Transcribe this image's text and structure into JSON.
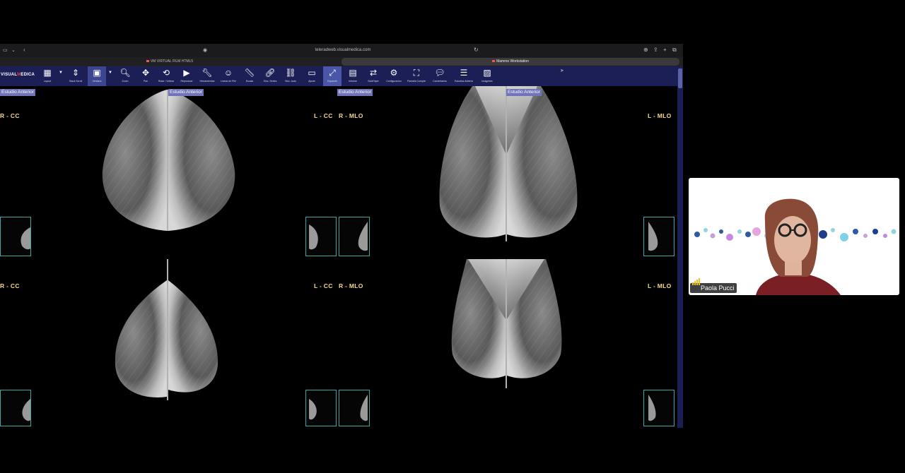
{
  "browser": {
    "url": "teleradweb.visualmedica.com",
    "tabs": [
      {
        "label": "VM VIRTUAL FILM HTML5"
      },
      {
        "label": "Mammo Workstation"
      }
    ]
  },
  "app": {
    "logo_prefix": "VISUAL",
    "logo_mark": "M",
    "logo_suffix": "EDICA"
  },
  "toolbar": [
    {
      "label": "Layout",
      "icon": "grid-icon"
    },
    {
      "label": "Stack Scroll",
      "icon": "scroll-arrows-icon"
    },
    {
      "label": "Ventana",
      "icon": "window-level-icon"
    },
    {
      "label": "Zoom",
      "icon": "magnifier-icon"
    },
    {
      "label": "Pan",
      "icon": "move-icon"
    },
    {
      "label": "Rotar / Voltear",
      "icon": "crop-rotate-icon"
    },
    {
      "label": "Reproducir",
      "icon": "play-icon"
    },
    {
      "label": "Herramientas",
      "icon": "wrench-icon"
    },
    {
      "label": "Lineas de Piel",
      "icon": "person-card-icon"
    },
    {
      "label": "Escala",
      "icon": "ruler-icon"
    },
    {
      "label": "Sinc. Series",
      "icon": "link-icon"
    },
    {
      "label": "Sinc. Auto",
      "icon": "link-auto-icon"
    },
    {
      "label": "Ajuste",
      "icon": "fit-icon"
    },
    {
      "label": "Expandir",
      "icon": "expand-icon"
    },
    {
      "label": "Informe",
      "icon": "report-icon"
    },
    {
      "label": "Sub/Hiper",
      "icon": "swap-icon"
    },
    {
      "label": "Configuracion",
      "icon": "settings-icon"
    },
    {
      "label": "Pantalla Completa",
      "icon": "fullscreen-icon"
    },
    {
      "label": "Comentarios",
      "icon": "comment-icon"
    },
    {
      "label": "Estudios Anteriores",
      "icon": "list-icon"
    },
    {
      "label": "Imagenes",
      "icon": "image-icon"
    }
  ],
  "viewer": {
    "badge": "Estudio Anterior",
    "labels": {
      "r_cc": "R - CC",
      "l_cc": "L - CC",
      "r_mlo": "R - MLO",
      "l_mlo": "L - MLO"
    }
  },
  "video": {
    "participant_name": "Paola Pucci"
  },
  "colors": {
    "toolbar_bg": "#1b1f56",
    "active_tool": "#4a57a8",
    "view_label": "#f5d98b",
    "thumb_border": "#3fa7a3",
    "badge_bg": "#6f75b8"
  }
}
